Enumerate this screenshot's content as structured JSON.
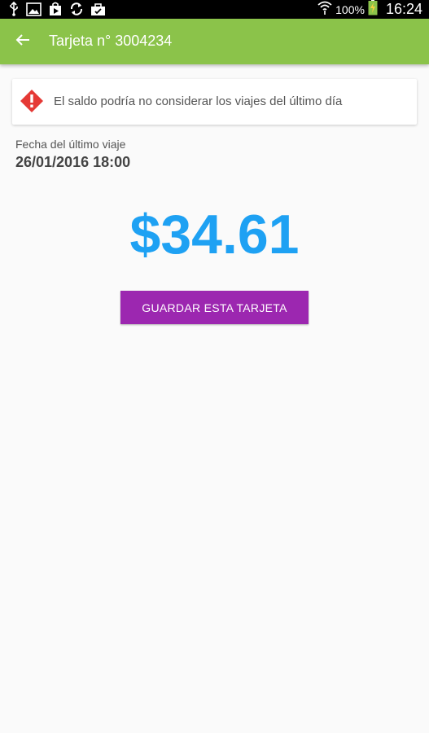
{
  "status_bar": {
    "left_icons": [
      "usb-icon",
      "image-icon",
      "play-store-icon",
      "sync-icon",
      "briefcase-icon"
    ],
    "wifi_icon": "wifi-icon",
    "battery_percent": "100%",
    "battery_icon": "battery-charging-icon",
    "time": "16:24"
  },
  "app_bar": {
    "back_icon": "arrow-back-icon",
    "title": "Tarjeta n° 3004234",
    "color": "#8bc34a"
  },
  "warning": {
    "icon": "warning-diamond-icon",
    "icon_color": "#e53935",
    "text": "El saldo podría no considerar los viajes del último día"
  },
  "last_trip": {
    "label": "Fecha del último viaje",
    "value": "26/01/2016 18:00"
  },
  "balance": {
    "amount": "$34.61",
    "color": "#1ea1f3"
  },
  "save_button": {
    "label": "GUARDAR ESTA TARJETA",
    "color": "#9c27b0"
  }
}
